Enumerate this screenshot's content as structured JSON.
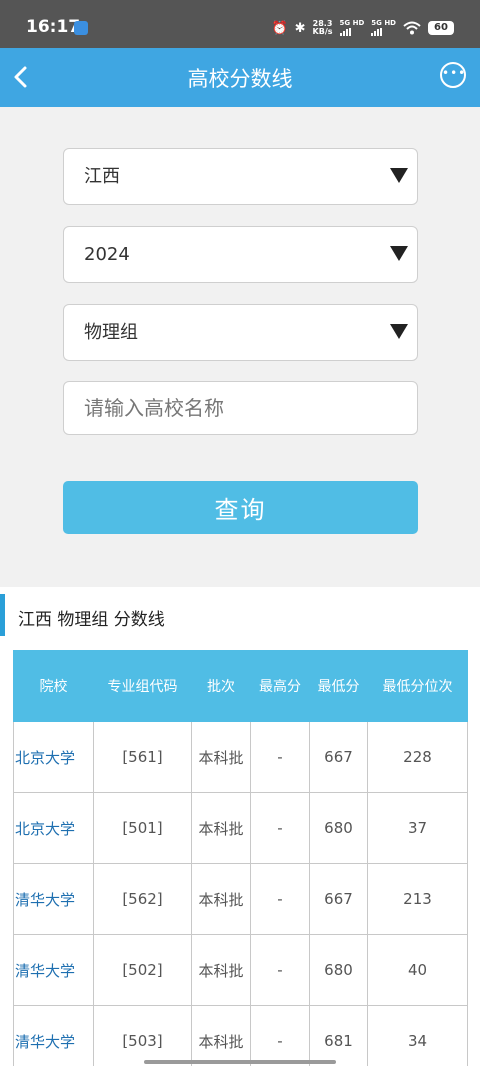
{
  "status_bar": {
    "time": "16:17",
    "speed_top": "28.3",
    "speed_unit": "KB/s",
    "net1": "5G HD",
    "net2": "5G HD",
    "battery": "60",
    "icons": [
      "notification-icon",
      "alarm-icon",
      "bluetooth-icon",
      "signal-icon",
      "wifi-icon",
      "battery-icon"
    ]
  },
  "header": {
    "title": "高校分数线",
    "back_icon": "chevron-left-icon",
    "more_icon": "more-icon"
  },
  "form": {
    "province": "江西",
    "year": "2024",
    "group": "物理组",
    "search_placeholder": "请输入高校名称",
    "search_value": "",
    "query_label": "查询"
  },
  "results": {
    "section_title": "江西 物理组 分数线",
    "columns": [
      "院校",
      "专业组代码",
      "批次",
      "最高分",
      "最低分",
      "最低分位次"
    ],
    "rows": [
      [
        "北京大学",
        "[561]",
        "本科批",
        "-",
        "667",
        "228"
      ],
      [
        "北京大学",
        "[501]",
        "本科批",
        "-",
        "680",
        "37"
      ],
      [
        "清华大学",
        "[562]",
        "本科批",
        "-",
        "667",
        "213"
      ],
      [
        "清华大学",
        "[502]",
        "本科批",
        "-",
        "680",
        "40"
      ],
      [
        "清华大学",
        "[503]",
        "本科批",
        "-",
        "681",
        "34"
      ]
    ]
  },
  "colors": {
    "header_bg": "#3fa6e2",
    "button_bg": "#50bde5",
    "school_link": "#1e6fb0"
  }
}
